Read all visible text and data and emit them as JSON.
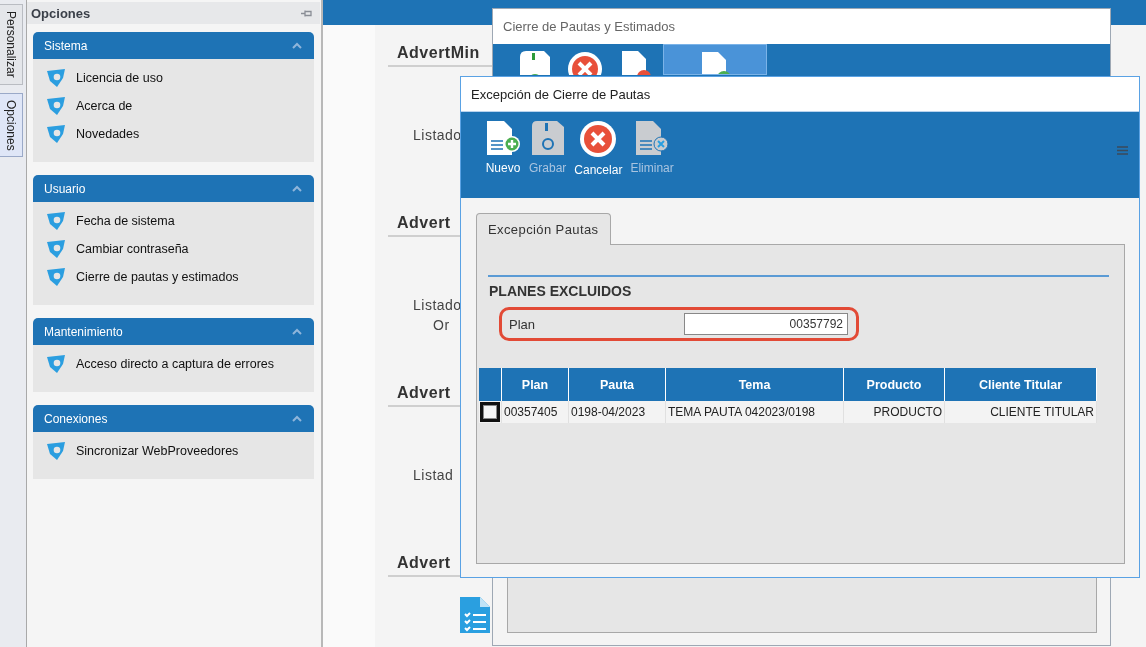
{
  "side_tabs": [
    {
      "label": "Personalizar",
      "selected": false
    },
    {
      "label": "Opciones",
      "selected": true
    }
  ],
  "options_panel": {
    "title": "Opciones",
    "groups": [
      {
        "title": "Sistema",
        "expanded": true,
        "items": [
          "Licencia de uso",
          "Acerca de",
          "Novedades"
        ]
      },
      {
        "title": "Usuario",
        "expanded": true,
        "items": [
          "Fecha de sistema",
          "Cambiar contraseña",
          "Cierre de pautas y estimados"
        ]
      },
      {
        "title": "Mantenimiento",
        "expanded": true,
        "items": [
          "Acceso directo a captura de errores"
        ]
      },
      {
        "title": "Conexiones",
        "expanded": true,
        "items": [
          "Sincronizar WebProveedores"
        ]
      }
    ]
  },
  "background": {
    "sections": [
      {
        "heading": "AdvertMin",
        "kind": "text",
        "labels": [
          "Listado"
        ]
      },
      {
        "heading": "Advert",
        "kind": "text",
        "labels": [
          "Listado",
          "Or"
        ]
      },
      {
        "heading": "Advert",
        "kind": "text",
        "labels": [
          "Listad"
        ]
      },
      {
        "heading": "Advert",
        "kind": "icon"
      }
    ]
  },
  "back_window": {
    "title": "Cierre de Pautas y Estimados",
    "toolbar": [
      {
        "kind": "save",
        "selected": false
      },
      {
        "kind": "cancel",
        "selected": false
      },
      {
        "kind": "delete",
        "selected": false
      },
      {
        "kind": "new",
        "selected": true
      }
    ]
  },
  "window": {
    "title": "Excepción de Cierre de Pautas",
    "toolbar": [
      {
        "label": "Nuevo",
        "kind": "new",
        "disabled": false
      },
      {
        "label": "Grabar",
        "kind": "save",
        "disabled": true
      },
      {
        "label": "Cancelar",
        "kind": "cancel",
        "disabled": false
      },
      {
        "label": "Eliminar",
        "kind": "delete",
        "disabled": true
      }
    ],
    "tabs": [
      {
        "label": "Excepción Pautas",
        "selected": true
      }
    ],
    "section_title": "PLANES EXCLUIDOS",
    "plan_field": {
      "label": "Plan",
      "value": "00357792"
    },
    "table": {
      "columns": [
        "Plan",
        "Pauta",
        "Tema",
        "Producto",
        "Cliente Titular"
      ],
      "rows": [
        {
          "checked": false,
          "cells": [
            "00357405",
            "0198-04/2023",
            "TEMA PAUTA 042023/0198",
            "PRODUCTO",
            "CLIENTE TITULAR"
          ]
        }
      ]
    }
  }
}
